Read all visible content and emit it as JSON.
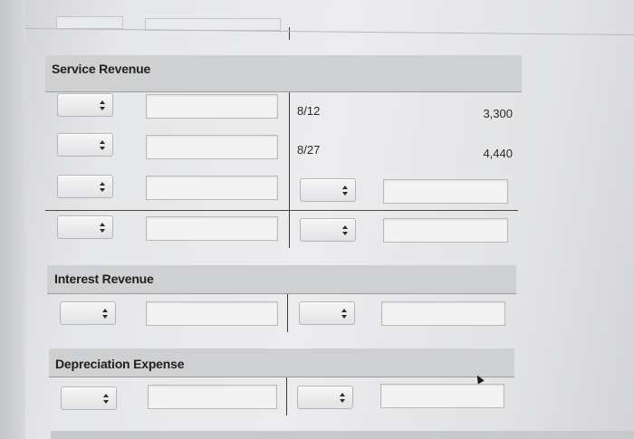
{
  "service_revenue": {
    "title": "Service Revenue",
    "rows": [
      {
        "date": "8/12",
        "amount": "3,300"
      },
      {
        "date": "8/27",
        "amount": "4,440"
      }
    ]
  },
  "interest_revenue": {
    "title": "Interest Revenue"
  },
  "depreciation_expense": {
    "title": "Depreciation Expense"
  },
  "icons": {
    "select": "updown-arrows-icon",
    "cursor": "mouse-pointer-icon"
  }
}
